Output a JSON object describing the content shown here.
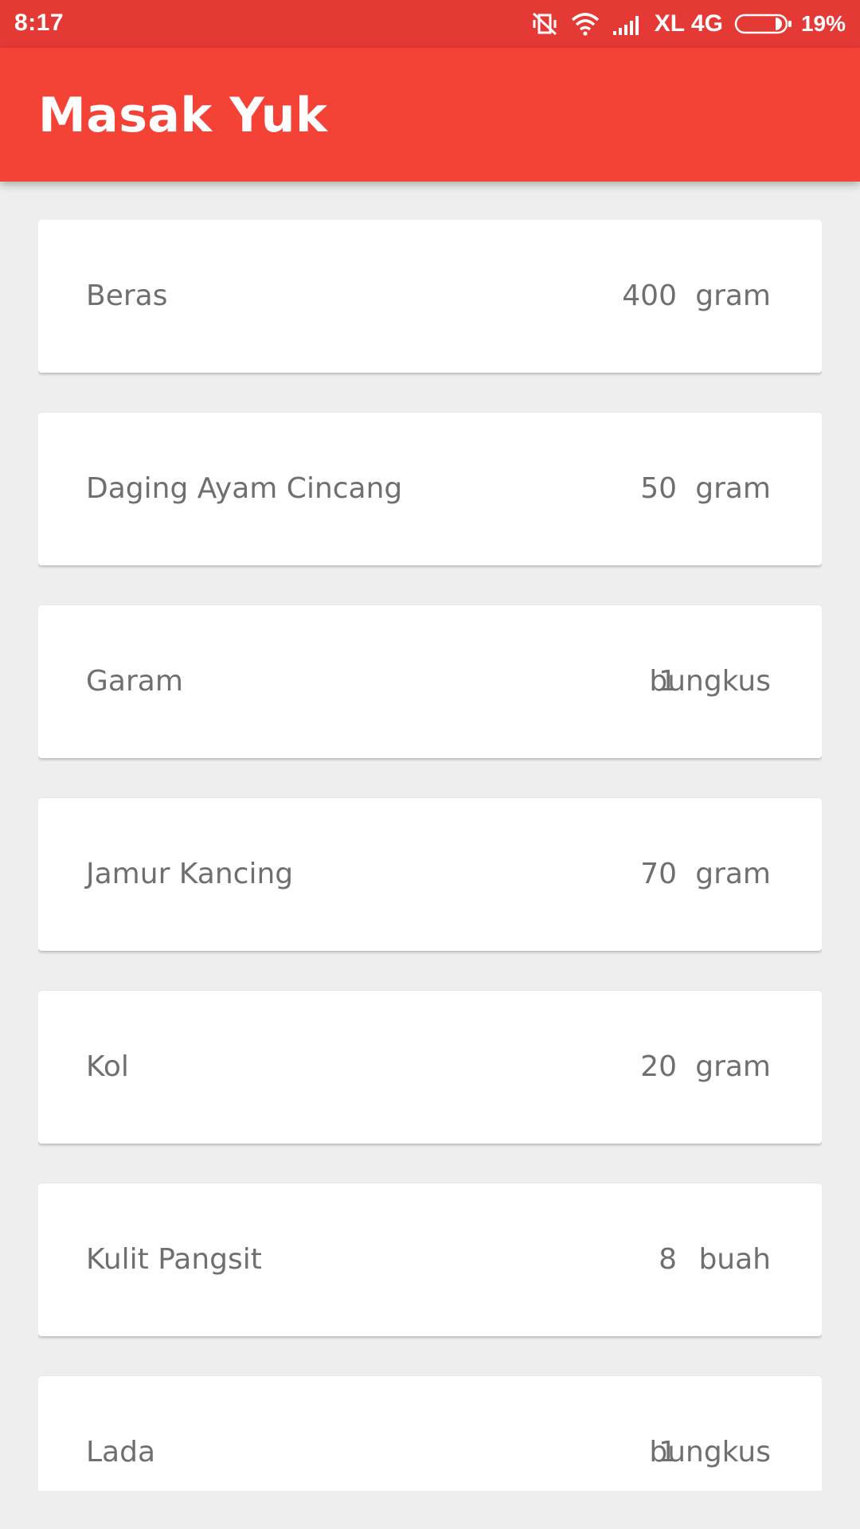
{
  "status_bar": {
    "time": "8:17",
    "carrier": "XL 4G",
    "battery": "19%",
    "icons": [
      "muted-vibrate-icon",
      "wifi-icon",
      "signal-icon",
      "battery-icon"
    ]
  },
  "app_bar": {
    "title": "Masak Yuk",
    "color": "#f44336",
    "status_color": "#e53935"
  },
  "ingredients": [
    {
      "name": "Beras",
      "qty": "400",
      "unit": "gram"
    },
    {
      "name": "Daging Ayam Cincang",
      "qty": "50",
      "unit": "gram"
    },
    {
      "name": "Garam",
      "qty": "1",
      "unit": "bungkus"
    },
    {
      "name": "Jamur Kancing",
      "qty": "70",
      "unit": "gram"
    },
    {
      "name": "Kol",
      "qty": "20",
      "unit": "gram"
    },
    {
      "name": "Kulit Pangsit",
      "qty": "8",
      "unit": "buah"
    },
    {
      "name": "Lada",
      "qty": "1",
      "unit": "bungkus"
    }
  ]
}
